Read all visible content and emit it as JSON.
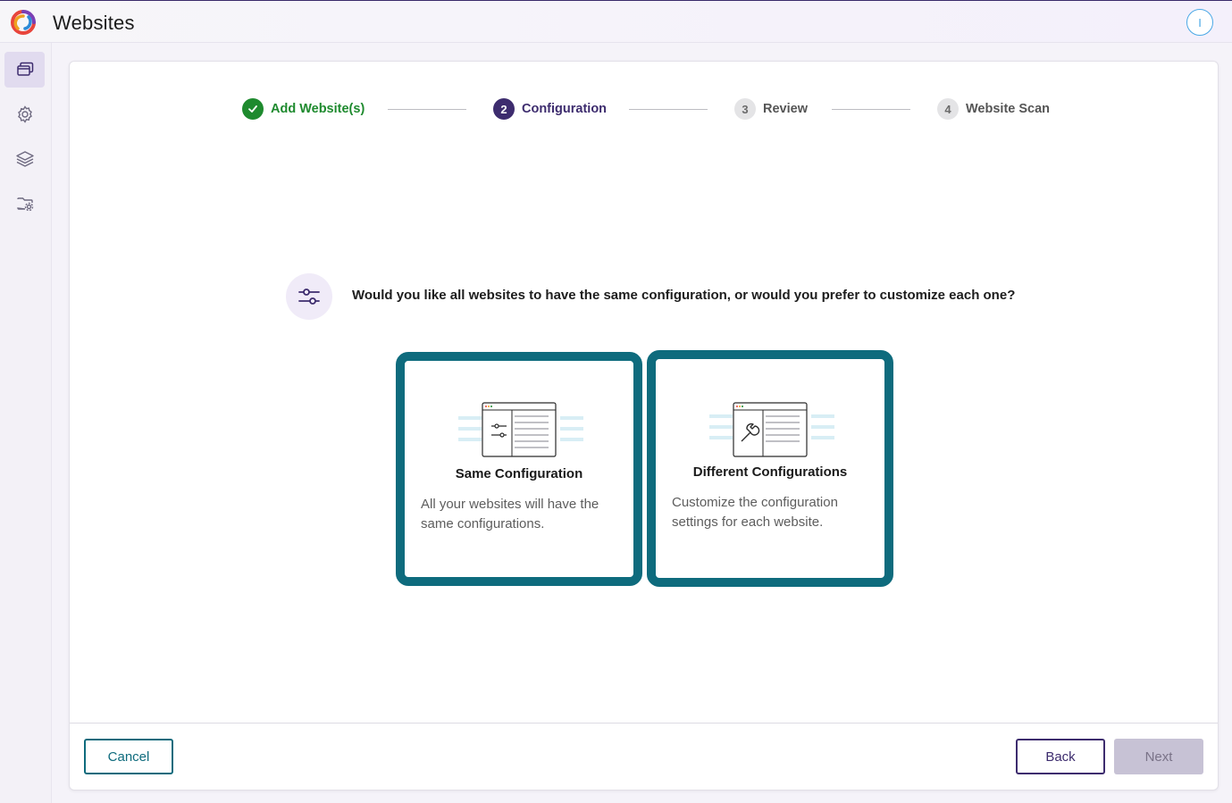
{
  "app": {
    "title": "Websites",
    "avatar_initial": "I"
  },
  "sidebar": {
    "items": [
      {
        "icon": "windows-icon",
        "active": true
      },
      {
        "icon": "gear-icon",
        "active": false
      },
      {
        "icon": "layers-icon",
        "active": false
      },
      {
        "icon": "folder-settings-icon",
        "active": false
      }
    ]
  },
  "stepper": {
    "steps": [
      {
        "number": "",
        "label": "Add Website(s)",
        "state": "completed"
      },
      {
        "number": "2",
        "label": "Configuration",
        "state": "current"
      },
      {
        "number": "3",
        "label": "Review",
        "state": "upcoming"
      },
      {
        "number": "4",
        "label": "Website Scan",
        "state": "upcoming"
      }
    ]
  },
  "question": {
    "icon": "sliders-icon",
    "text": "Would you like all websites to have the same configuration, or would you prefer to customize each one?"
  },
  "options": [
    {
      "icon": "sliders-window-icon",
      "title": "Same Configuration",
      "description": "All your websites will have the same configurations."
    },
    {
      "icon": "wrench-window-icon",
      "title": "Different Configurations",
      "description": "Customize the configuration settings for each website."
    }
  ],
  "footer": {
    "cancel_label": "Cancel",
    "back_label": "Back",
    "next_label": "Next"
  },
  "colors": {
    "primary": "#3d2c6e",
    "teal": "#0e6b7d",
    "success": "#1e8a2e",
    "disabled": "#c7c2d5"
  }
}
